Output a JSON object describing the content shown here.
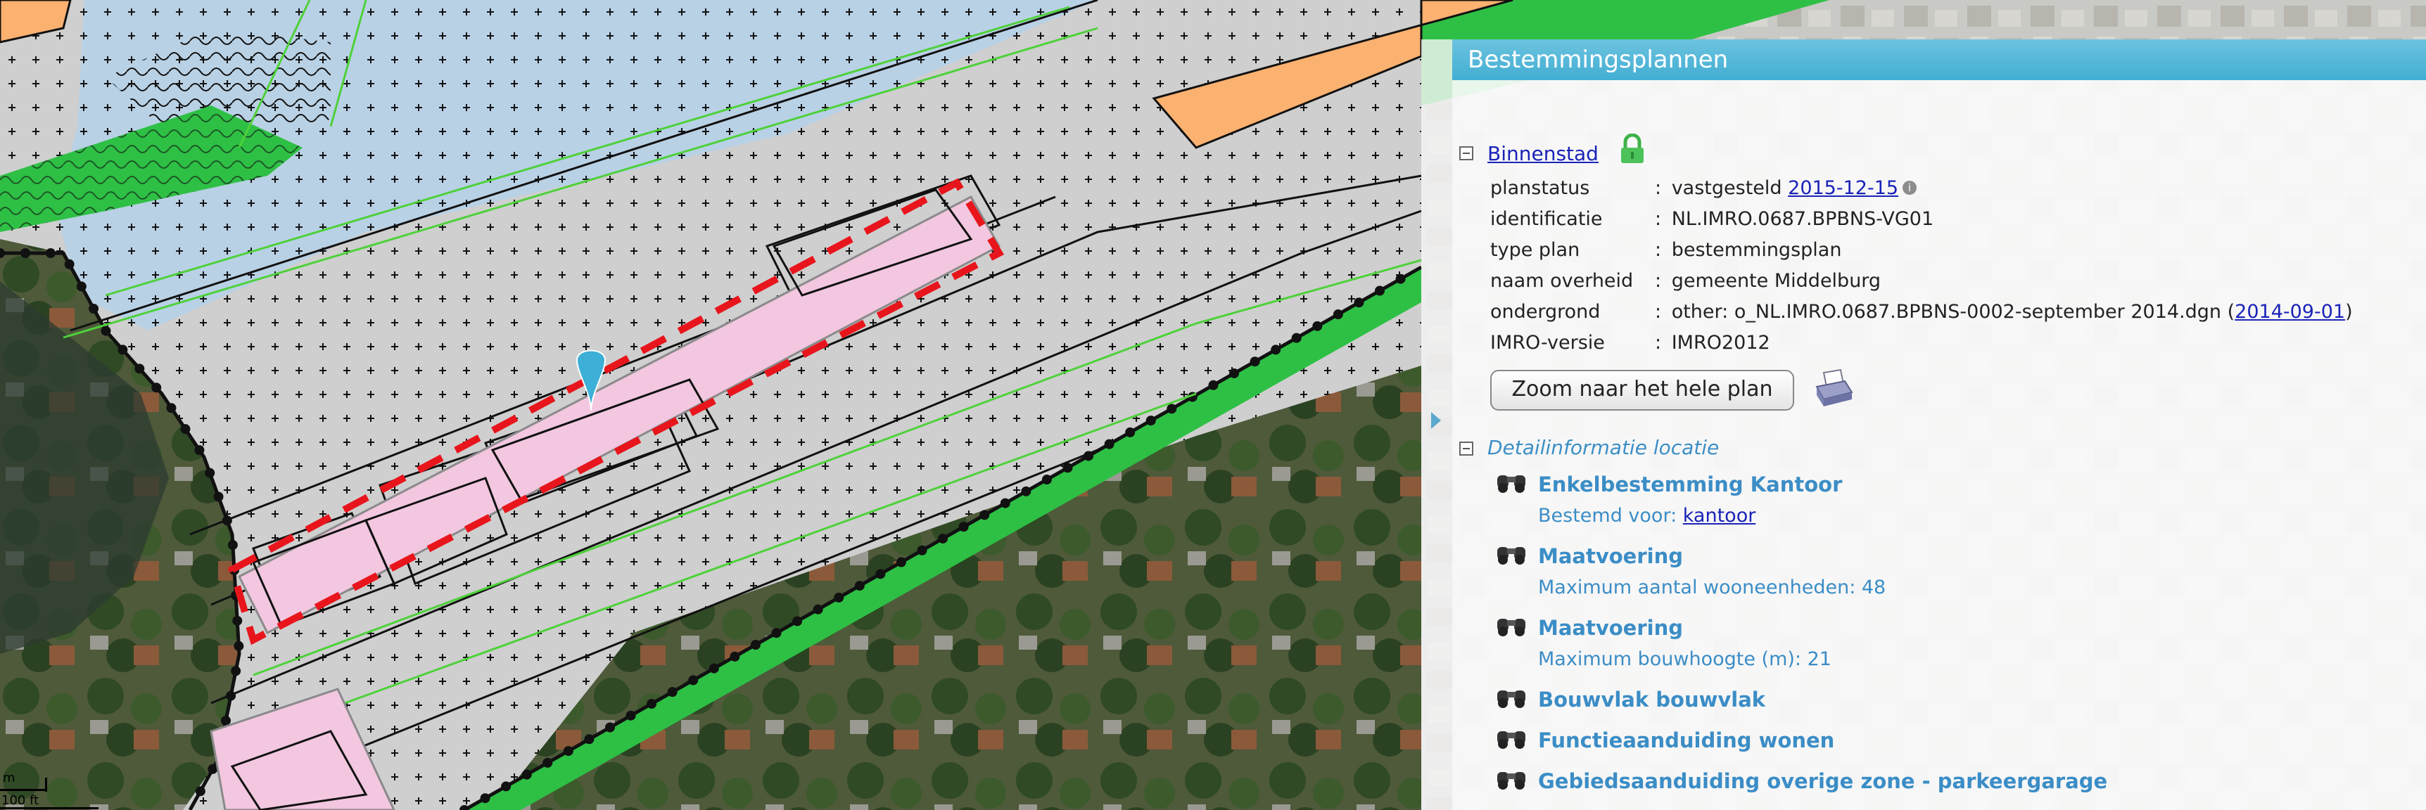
{
  "panel": {
    "title": "Bestemmingsplannen",
    "plan_name": "Binnenstad",
    "meta": [
      {
        "label": "planstatus",
        "sep": ":",
        "value": "vastgesteld",
        "link": "2015-12-15"
      },
      {
        "label": "identificatie",
        "sep": ":",
        "value": "NL.IMRO.0687.BPBNS-VG01"
      },
      {
        "label": "type plan",
        "sep": ":",
        "value": "bestemmingsplan"
      },
      {
        "label": "naam overheid",
        "sep": ":",
        "value": "gemeente Middelburg"
      },
      {
        "label": "ondergrond",
        "sep": ":",
        "value": "other: o_NL.IMRO.0687.BPBNS-0002-september 2014.dgn (",
        "link": "2014-09-01",
        "suffix": ")"
      },
      {
        "label": "IMRO-versie",
        "sep": ":",
        "value": "IMRO2012"
      }
    ],
    "zoom_button": "Zoom naar het hele plan",
    "detail_title": "Detailinformatie locatie",
    "details": [
      {
        "head": "Enkelbestemming Kantoor",
        "sub": "Bestemd voor:",
        "sub_link": "kantoor"
      },
      {
        "head": "Maatvoering",
        "sub": "Maximum aantal wooneenheden: 48"
      },
      {
        "head": "Maatvoering",
        "sub": "Maximum bouwhoogte (m): 21"
      },
      {
        "head": "Bouwvlak bouwvlak"
      },
      {
        "head": "Functieaanduiding wonen"
      },
      {
        "head": "Gebiedsaanduiding overige zone - parkeergarage"
      }
    ]
  },
  "scale_bar": {
    "metric": "m",
    "imperial": "100 ft"
  },
  "colors": {
    "header": "#42aed3",
    "link": "#1a23b8",
    "detail_text": "#3b8dc6",
    "zone_grey": "#cfcfcf",
    "water_blue": "#b7d1e6",
    "green_zone": "#2ec045",
    "orange_zone": "#fbb170",
    "pink_zone": "#f2c7df",
    "selection": "#e8151c"
  },
  "icons": {
    "plan_toggle": "collapse-icon",
    "lock": "lock-icon",
    "print": "print-icon",
    "detail": "binoculars-icon",
    "marker": "location-marker-icon"
  }
}
